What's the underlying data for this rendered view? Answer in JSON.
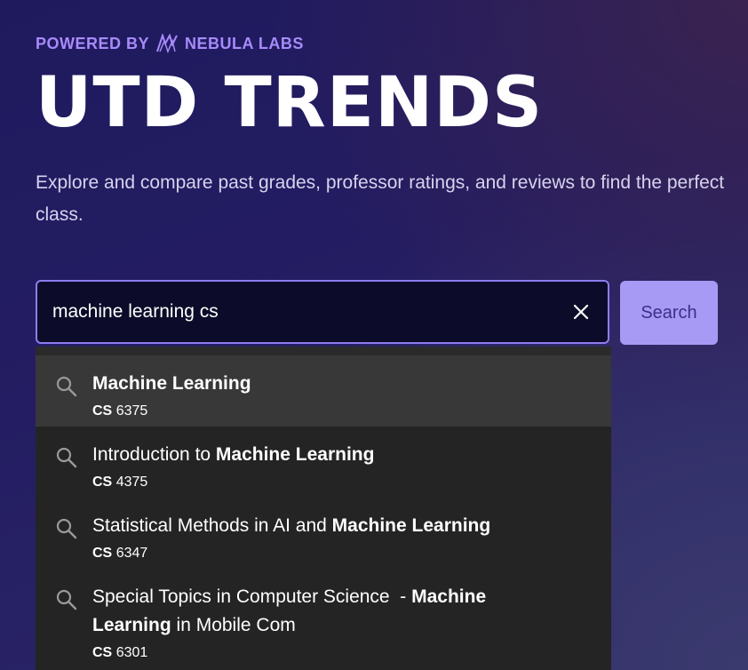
{
  "header": {
    "powered_prefix": "POWERED BY",
    "brand": "NEBULA LABS",
    "title": "UTD TRENDS",
    "subtitle": "Explore and compare past grades, professor ratings, and reviews to find the perfect class."
  },
  "search": {
    "value": "machine learning cs",
    "button_label": "Search"
  },
  "suggestions": [
    {
      "pre": "",
      "bold": "Machine Learning",
      "post": "",
      "pre2": "",
      "bold2": "",
      "post2": "",
      "prefix": "CS",
      "number": "6375",
      "active": true
    },
    {
      "pre": "Introduction to ",
      "bold": "Machine Learning",
      "post": "",
      "prefix": "CS",
      "number": "4375"
    },
    {
      "pre": "Statistical Methods in AI and ",
      "bold": "Machine Learning",
      "post": "",
      "prefix": "CS",
      "number": "6347"
    },
    {
      "pre": "Special Topics in Computer Science  - ",
      "bold": "Machine",
      "post": "",
      "line2_bold": "Learning",
      "line2_post": " in Mobile Com",
      "prefix": "CS",
      "number": "6301"
    }
  ],
  "colors": {
    "accent": "#a78bfa",
    "search_button_bg": "#a79af5",
    "input_border": "#8f7cf0",
    "dropdown_bg": "#242424",
    "dropdown_active_bg": "#383838"
  },
  "icons": {
    "brand_logo": "nebula-logo-icon",
    "clear": "close-icon",
    "suggestion": "search-icon"
  }
}
